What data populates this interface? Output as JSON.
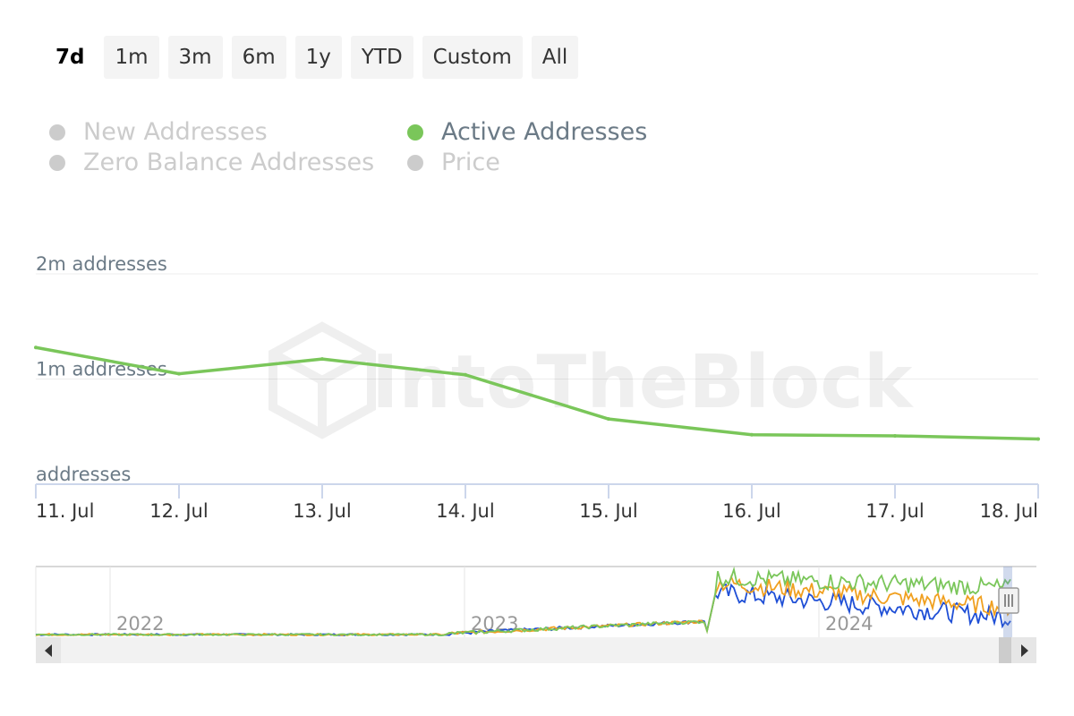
{
  "range_selector": {
    "buttons": [
      "7d",
      "1m",
      "3m",
      "6m",
      "1y",
      "YTD",
      "Custom",
      "All"
    ],
    "active": "7d"
  },
  "legend": [
    {
      "label": "New Addresses",
      "enabled": false
    },
    {
      "label": "Active Addresses",
      "enabled": true,
      "color": "#7ac65a"
    },
    {
      "label": "Zero Balance Addresses",
      "enabled": false
    },
    {
      "label": "Price",
      "enabled": false
    }
  ],
  "watermark": "IntoTheBlock",
  "colors": {
    "active": "#7ac65a",
    "inactive": "#cccccc",
    "new": "#1f4fd6",
    "zero": "#f0a020"
  },
  "chart_data": {
    "type": "line",
    "x": [
      "11. Jul",
      "12. Jul",
      "13. Jul",
      "14. Jul",
      "15. Jul",
      "16. Jul",
      "17. Jul",
      "18. Jul"
    ],
    "series": [
      {
        "name": "Active Addresses",
        "values": [
          1300000,
          1050000,
          1190000,
          1040000,
          620000,
          470000,
          460000,
          430000
        ]
      }
    ],
    "y_ticks": [
      {
        "value": 0,
        "label": "addresses"
      },
      {
        "value": 1000000,
        "label": "1m addresses"
      },
      {
        "value": 2000000,
        "label": "2m addresses"
      }
    ],
    "ylim": [
      0,
      2000000
    ],
    "grid": true,
    "navigator": {
      "year_labels": [
        "2022",
        "2023",
        "2024"
      ]
    }
  }
}
